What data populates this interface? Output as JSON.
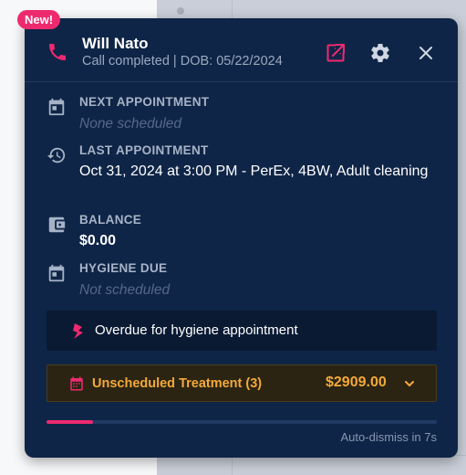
{
  "badge": {
    "label": "New!"
  },
  "header": {
    "caller_name": "Will Nato",
    "subtitle": "Call completed | DOB: 05/22/2024",
    "icons": [
      "phone-icon",
      "open-external-icon",
      "gear-icon",
      "close-icon"
    ]
  },
  "fields": {
    "next_appointment": {
      "label": "NEXT APPOINTMENT",
      "value": "None scheduled"
    },
    "last_appointment": {
      "label": "LAST APPOINTMENT",
      "value": "Oct 31, 2024 at 3:00 PM - PerEx, 4BW, Adult cleaning"
    },
    "balance": {
      "label": "BALANCE",
      "value": "$0.00"
    },
    "hygiene_due": {
      "label": "HYGIENE DUE",
      "value": "Not scheduled"
    }
  },
  "alert": {
    "text": "Overdue for hygiene appointment"
  },
  "unscheduled": {
    "label": "Unscheduled Treatment (3)",
    "amount": "$2909.00"
  },
  "dismiss": {
    "text": "Auto-dismiss in 7s",
    "progress": 0.12
  },
  "colors": {
    "card_bg": "#0f2547",
    "accent_pink": "#ee2a6f",
    "warning_orange": "#f4a93a",
    "muted_text": "#9aa9c0"
  }
}
